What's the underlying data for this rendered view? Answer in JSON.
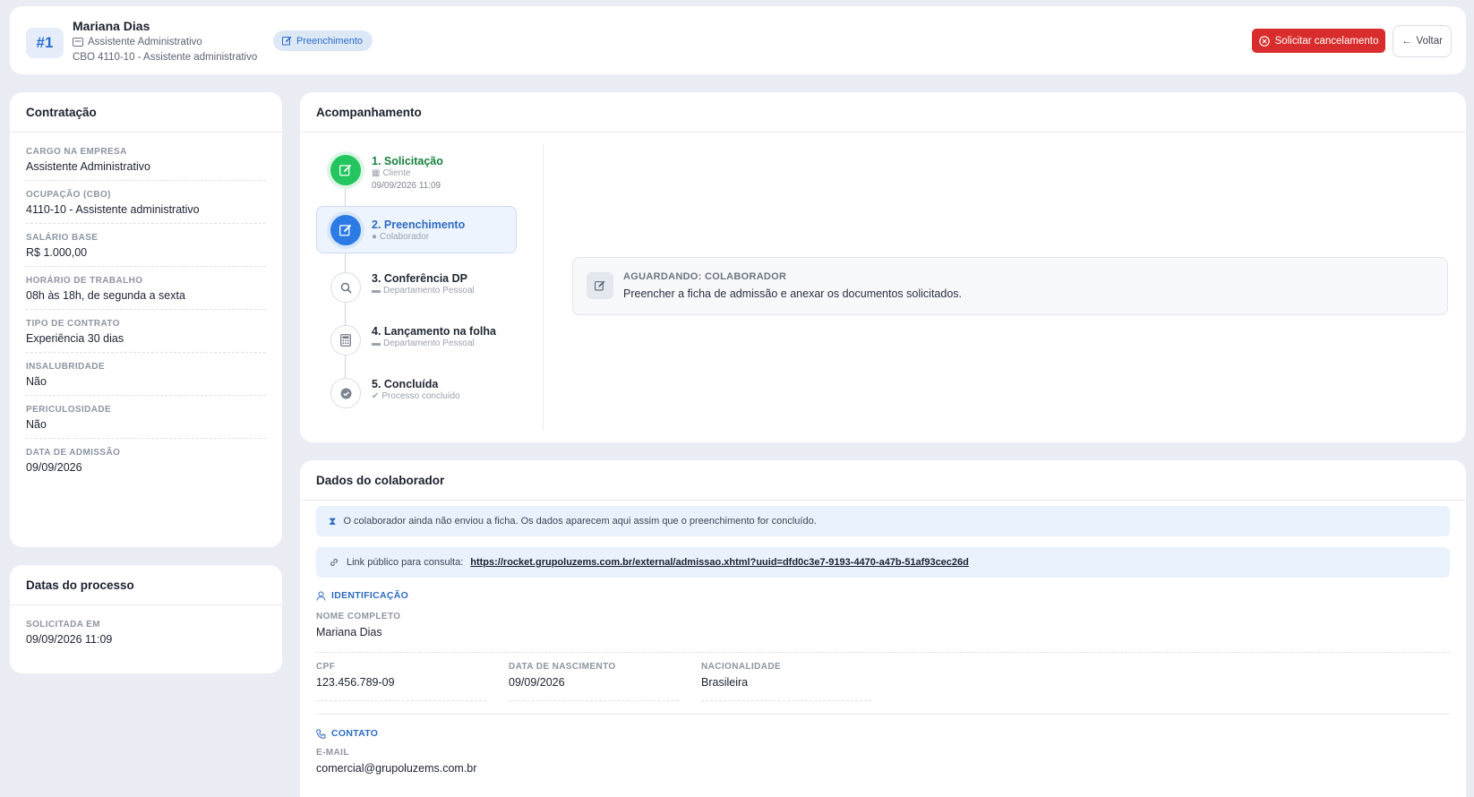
{
  "header": {
    "number": "#1",
    "name": "Mariana Dias",
    "role": "Assistente Administrativo",
    "cbo": "CBO 4110-10 - Assistente administrativo",
    "status": "Preenchimento",
    "cancel_label": "Solicitar cancelamento",
    "back_label": "Voltar"
  },
  "contratacao": {
    "title": "Contratação",
    "fields": [
      {
        "label": "CARGO NA EMPRESA",
        "value": "Assistente Administrativo"
      },
      {
        "label": "OCUPAÇÃO (CBO)",
        "value": "4110-10 - Assistente administrativo"
      },
      {
        "label": "SALÁRIO BASE",
        "value": "R$  1.000,00"
      },
      {
        "label": "HORÁRIO DE TRABALHO",
        "value": "08h às 18h, de segunda a sexta"
      },
      {
        "label": "TIPO DE CONTRATO",
        "value": "Experiência 30 dias"
      },
      {
        "label": "INSALUBRIDADE",
        "value": "Não"
      },
      {
        "label": "PERICULOSIDADE",
        "value": "Não"
      },
      {
        "label": "DATA DE ADMISSÃO",
        "value": "09/09/2026"
      }
    ]
  },
  "datas": {
    "title": "Datas do processo",
    "label": "SOLICITADA EM",
    "value": "09/09/2026 11:09"
  },
  "acompanhamento": {
    "title": "Acompanhamento",
    "steps": [
      {
        "title": "1. Solicitação",
        "sub": "Cliente",
        "date": "09/09/2026 11:09",
        "icon": "edit-icon",
        "state": "done"
      },
      {
        "title": "2. Preenchimento",
        "sub": "Colaborador",
        "date": "",
        "icon": "edit-icon",
        "state": "active"
      },
      {
        "title": "3. Conferência DP",
        "sub": "Departamento Pessoal",
        "date": "",
        "icon": "search-icon",
        "state": "pending"
      },
      {
        "title": "4. Lançamento na folha",
        "sub": "Departamento Pessoal",
        "date": "",
        "icon": "calculator-icon",
        "state": "pending"
      },
      {
        "title": "5. Concluída",
        "sub": "Processo concluído",
        "date": "",
        "icon": "check-circle-icon",
        "state": "pending"
      }
    ],
    "awaiting_title": "AGUARDANDO: COLABORADOR",
    "awaiting_text": "Preencher a ficha de admissão e anexar os documentos solicitados."
  },
  "dados": {
    "title": "Dados do colaborador",
    "notice": "O colaborador ainda não enviou a ficha. Os dados aparecem aqui assim que o preenchimento for concluído.",
    "link_label": "Link público para consulta:",
    "link_url": "https://rocket.grupoluzems.com.br/external/admissao.xhtml?uuid=dfd0c3e7-9193-4470-a47b-51af93cec26d",
    "identificacao": {
      "heading": "IDENTIFICAÇÃO",
      "nome_label": "NOME COMPLETO",
      "nome": "Mariana Dias",
      "cpf_label": "CPF",
      "cpf": "123.456.789-09",
      "nasc_label": "DATA DE NASCIMENTO",
      "nasc": "09/09/2026",
      "nac_label": "NACIONALIDADE",
      "nac": "Brasileira"
    },
    "contato": {
      "heading": "CONTATO",
      "email_label": "E-MAIL",
      "email": "comercial@grupoluzems.com.br"
    }
  },
  "colors": {
    "accent": "#2c6bc4",
    "success": "#22c55e",
    "danger": "#d92d2d",
    "background": "#e9edf3"
  }
}
